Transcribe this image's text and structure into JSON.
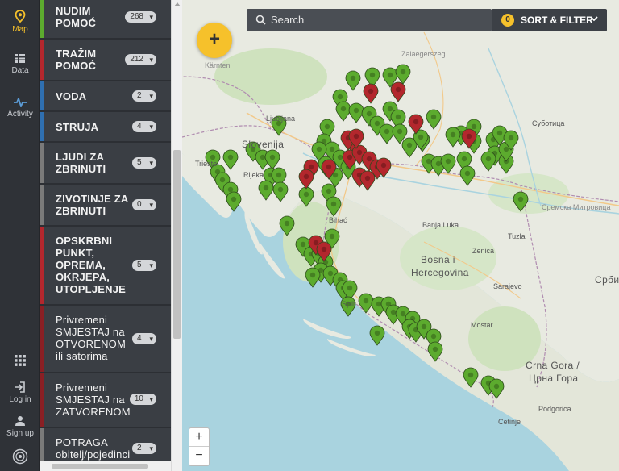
{
  "rail": {
    "map_label": "Map",
    "data_label": "Data",
    "activity_label": "Activity",
    "login_label": "Log in",
    "signup_label": "Sign up"
  },
  "categories": [
    {
      "label": "NUDIM POMOĆ",
      "count": "268",
      "color": "#5cab2e"
    },
    {
      "label": "TRAŽIM POMOĆ",
      "count": "212",
      "color": "#b3272d"
    },
    {
      "label": "VODA",
      "count": "2",
      "color": "#2f6fb0"
    },
    {
      "label": "STRUJA",
      "count": "4",
      "color": "#2f6fb0"
    },
    {
      "label": "LJUDI ZA ZBRINUTI",
      "count": "5",
      "color": "#7a7a7a"
    },
    {
      "label": "ZIVOTINJE ZA ZBRINUTI",
      "count": "0",
      "color": "#7a7a7a"
    },
    {
      "label": "OPSKRBNI PUNKT, OPREMA, OKRJEPA, UTOPLJENJE",
      "count": "5",
      "color": "#b3272d"
    },
    {
      "label": "Privremeni SMJESTAJ na OTVORENOM ili satorima",
      "count": "4",
      "color": "#8a1f24"
    },
    {
      "label": "Privremeni SMJESTAJ na ZATVORENOM",
      "count": "10",
      "color": "#8a1f24"
    },
    {
      "label": "POTRAGA obitelj/pojedinci",
      "count": "2",
      "color": "#7a7a7a"
    }
  ],
  "toolbar": {
    "search_placeholder": "Search",
    "filter_count": "0",
    "sort_filter_label": "SORT & FILTER",
    "add_label": "+"
  },
  "zoom": {
    "in_label": "+",
    "out_label": "−"
  },
  "map_labels": {
    "slovenija": "Slovenija",
    "ljubljana": "Ljubljana",
    "bihac": "Bihać",
    "banja_luka": "Banja Luka",
    "bosna": "Bosna i",
    "hercegovina": "Hercegovina",
    "sarajevo": "Sarajevo",
    "mostar": "Mostar",
    "srbija": "Србиј",
    "crna_gora": "Crna Gora /",
    "crna_gora_cyr": "Црна Гора",
    "podgorica": "Podgorica",
    "cetinje": "Cetinje",
    "zalaegerszeg": "Zalaegerszeg",
    "subotica": "Суботица",
    "sremska": "Сремска Митровица",
    "karnten": "Kärnten",
    "zadar_area": "Split",
    "tuzla": "Tuzla",
    "zenica": "Zenica",
    "trieste": "Trieste",
    "rijeka": "Rijeka"
  },
  "colors": {
    "accent": "#f6c12b",
    "pin_green": "#5cab2e",
    "pin_red": "#b3272d",
    "sea": "#a9d3df",
    "land": "#e8eae1"
  }
}
